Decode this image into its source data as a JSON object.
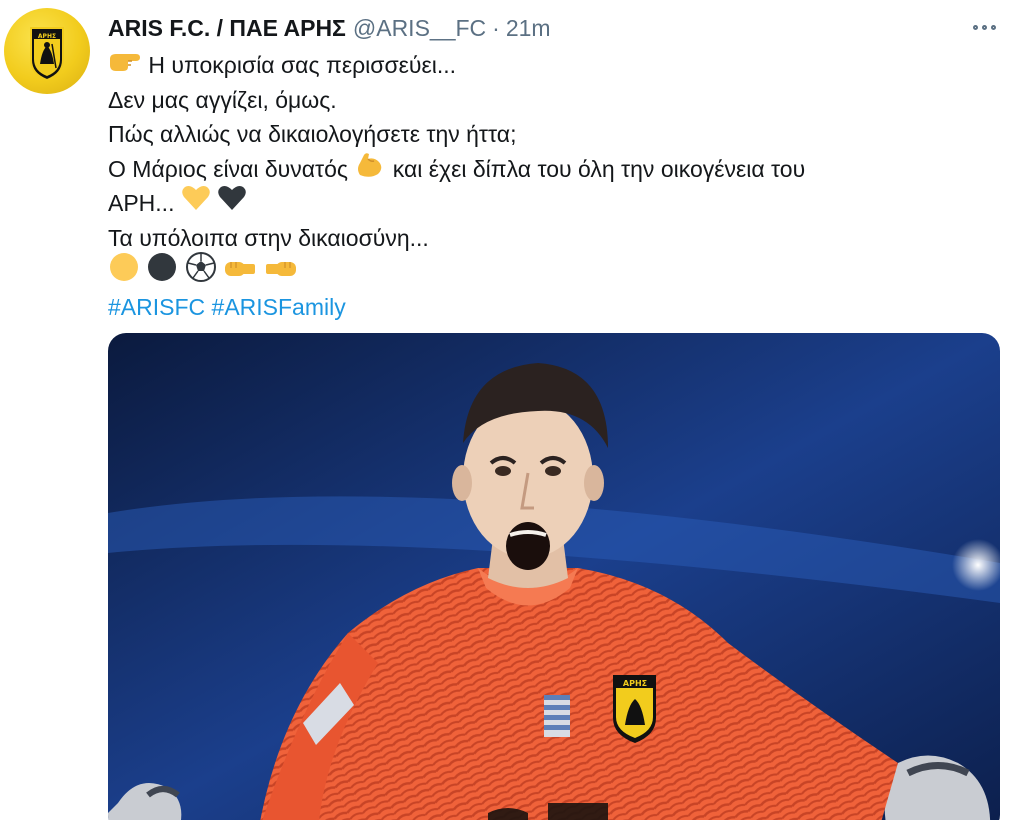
{
  "tweet": {
    "display_name": "ARIS F.C. / ΠΑΕ ΑΡΗΣ",
    "handle": "@ARIS__FC",
    "separator": "·",
    "time": "21m",
    "avatar_icon": "aris-crest-icon",
    "more_icon": "more-options-icon",
    "lines": [
      "Η υποκρισία σας περισσεύει...",
      "Δεν μας αγγίζει, όμως.",
      "Πώς αλλιώς να δικαιολογήσετε την ήττα;",
      "Ο Μάριος είναι δυνατός",
      "και έχει δίπλα του όλη την οικογένεια του",
      "ΑΡΗ...",
      "Τα υπόλοιπα στην δικαιοσύνη..."
    ],
    "hashtags": [
      "#ARISFC",
      "#ARISFamily"
    ],
    "emojis": [
      "backhand-index-pointing-right",
      "flexed-biceps",
      "yellow-heart",
      "black-heart",
      "yellow-circle",
      "black-circle",
      "soccer-ball",
      "left-facing-fist",
      "right-facing-fist"
    ],
    "media": {
      "description_icon": "goalkeeper-photo",
      "crest_text": "ΑΡΗΣ"
    },
    "colors": {
      "text": "#14171a",
      "muted": "#5b7083",
      "link": "#1b95e0",
      "brand_yellow": "#f2cc1d",
      "jersey": "#f0623a"
    }
  }
}
